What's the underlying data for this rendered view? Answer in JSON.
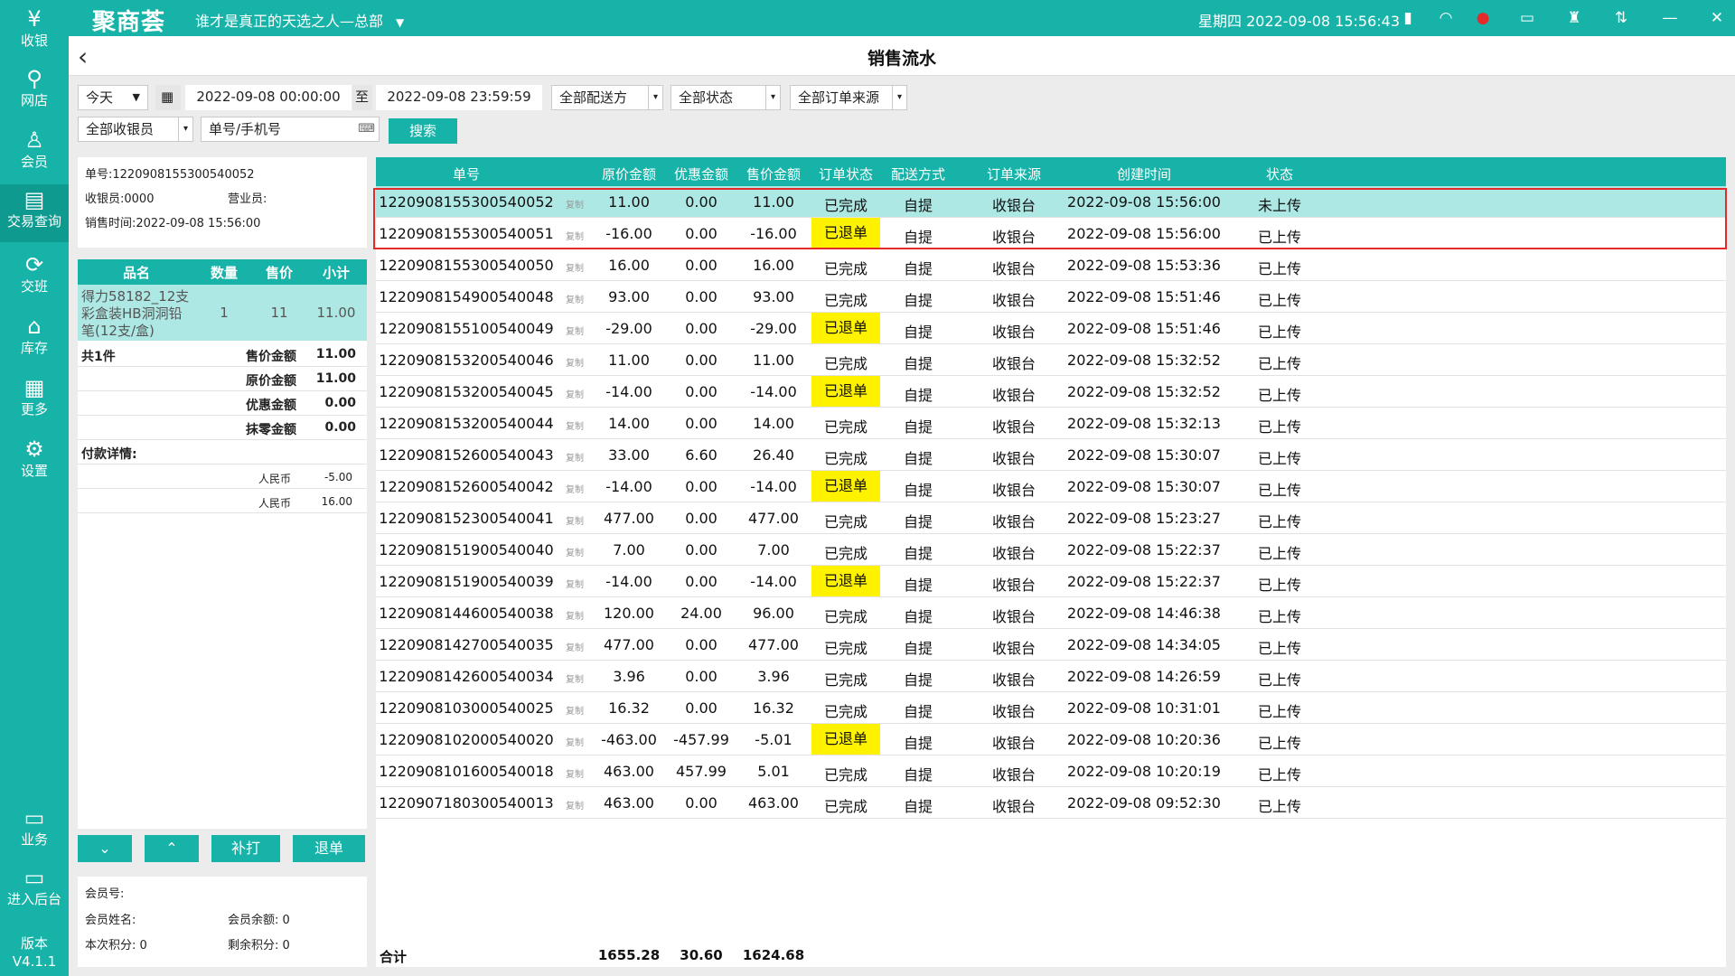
{
  "app": {
    "logo": "聚商荟",
    "store_name": "谁才是真正的天选之人—总部",
    "datetime": "星期四 2022-09-08 15:56:43"
  },
  "sidebar": {
    "items": [
      {
        "label": "收银",
        "icon": "cash-register-icon"
      },
      {
        "label": "网店",
        "icon": "bike-icon"
      },
      {
        "label": "会员",
        "icon": "user-icon"
      },
      {
        "label": "交易查询",
        "icon": "document-icon"
      },
      {
        "label": "交班",
        "icon": "shift-icon"
      },
      {
        "label": "库存",
        "icon": "warehouse-icon"
      },
      {
        "label": "更多",
        "icon": "grid-icon"
      },
      {
        "label": "设置",
        "icon": "gear-icon"
      },
      {
        "label": "业务",
        "icon": "clipboard-icon"
      },
      {
        "label": "进入后台",
        "icon": "monitor-icon"
      }
    ],
    "version_label": "版本",
    "version": "V4.1.1"
  },
  "page": {
    "title": "销售流水"
  },
  "filters": {
    "period": "今天",
    "start": "2022-09-08 00:00:00",
    "to": "至",
    "end": "2022-09-08 23:59:59",
    "delivery": "全部配送方",
    "status": "全部状态",
    "source": "全部订单来源",
    "cashier": "全部收银员",
    "search_placeholder": "单号/手机号",
    "search_button": "搜索"
  },
  "detail": {
    "order_no": "单号:1220908155300540052",
    "cashier": "收银员:0000",
    "salesperson": "营业员:",
    "time": "销售时间:2022-09-08 15:56:00",
    "item_headers": {
      "name": "品名",
      "qty": "数量",
      "price": "售价",
      "subtotal": "小计"
    },
    "item": {
      "name": "得力58182_12支彩盒装HB洞洞铅笔(12支/盒)",
      "qty": "1",
      "price": "11",
      "subtotal": "11.00"
    },
    "count": "共1件",
    "sums": [
      {
        "label": "售价金额",
        "value": "11.00"
      },
      {
        "label": "原价金额",
        "value": "11.00"
      },
      {
        "label": "优惠金额",
        "value": "0.00"
      },
      {
        "label": "抹零金额",
        "value": "0.00"
      }
    ],
    "pay_title": "付款详情:",
    "payments": [
      {
        "method": "人民币",
        "amount": "-5.00"
      },
      {
        "method": "人民币",
        "amount": "16.00"
      }
    ],
    "buttons": {
      "reprint": "补打",
      "refund": "退单"
    },
    "member": {
      "no": "会员号:",
      "name": "会员姓名:",
      "balance": "会员余额:  0",
      "points": "本次积分:  0",
      "remaining": "剩余积分:  0"
    }
  },
  "table": {
    "headers": [
      "单号",
      "原价金额",
      "优惠金额",
      "售价金额",
      "订单状态",
      "配送方式",
      "订单来源",
      "创建时间",
      "状态"
    ],
    "copy_label": "复制",
    "rows": [
      {
        "no": "1220908155300540052",
        "orig": "11.00",
        "disc": "0.00",
        "sale": "11.00",
        "status": "已完成",
        "delivery": "自提",
        "source": "收银台",
        "time": "2022-09-08 15:56:00",
        "upload": "未上传"
      },
      {
        "no": "1220908155300540051",
        "orig": "-16.00",
        "disc": "0.00",
        "sale": "-16.00",
        "status": "已退单",
        "delivery": "自提",
        "source": "收银台",
        "time": "2022-09-08 15:56:00",
        "upload": "已上传"
      },
      {
        "no": "1220908155300540050",
        "orig": "16.00",
        "disc": "0.00",
        "sale": "16.00",
        "status": "已完成",
        "delivery": "自提",
        "source": "收银台",
        "time": "2022-09-08 15:53:36",
        "upload": "已上传"
      },
      {
        "no": "1220908154900540048",
        "orig": "93.00",
        "disc": "0.00",
        "sale": "93.00",
        "status": "已完成",
        "delivery": "自提",
        "source": "收银台",
        "time": "2022-09-08 15:51:46",
        "upload": "已上传"
      },
      {
        "no": "1220908155100540049",
        "orig": "-29.00",
        "disc": "0.00",
        "sale": "-29.00",
        "status": "已退单",
        "delivery": "自提",
        "source": "收银台",
        "time": "2022-09-08 15:51:46",
        "upload": "已上传"
      },
      {
        "no": "1220908153200540046",
        "orig": "11.00",
        "disc": "0.00",
        "sale": "11.00",
        "status": "已完成",
        "delivery": "自提",
        "source": "收银台",
        "time": "2022-09-08 15:32:52",
        "upload": "已上传"
      },
      {
        "no": "1220908153200540045",
        "orig": "-14.00",
        "disc": "0.00",
        "sale": "-14.00",
        "status": "已退单",
        "delivery": "自提",
        "source": "收银台",
        "time": "2022-09-08 15:32:52",
        "upload": "已上传"
      },
      {
        "no": "1220908153200540044",
        "orig": "14.00",
        "disc": "0.00",
        "sale": "14.00",
        "status": "已完成",
        "delivery": "自提",
        "source": "收银台",
        "time": "2022-09-08 15:32:13",
        "upload": "已上传"
      },
      {
        "no": "1220908152600540043",
        "orig": "33.00",
        "disc": "6.60",
        "sale": "26.40",
        "status": "已完成",
        "delivery": "自提",
        "source": "收银台",
        "time": "2022-09-08 15:30:07",
        "upload": "已上传"
      },
      {
        "no": "1220908152600540042",
        "orig": "-14.00",
        "disc": "0.00",
        "sale": "-14.00",
        "status": "已退单",
        "delivery": "自提",
        "source": "收银台",
        "time": "2022-09-08 15:30:07",
        "upload": "已上传"
      },
      {
        "no": "1220908152300540041",
        "orig": "477.00",
        "disc": "0.00",
        "sale": "477.00",
        "status": "已完成",
        "delivery": "自提",
        "source": "收银台",
        "time": "2022-09-08 15:23:27",
        "upload": "已上传"
      },
      {
        "no": "1220908151900540040",
        "orig": "7.00",
        "disc": "0.00",
        "sale": "7.00",
        "status": "已完成",
        "delivery": "自提",
        "source": "收银台",
        "time": "2022-09-08 15:22:37",
        "upload": "已上传"
      },
      {
        "no": "1220908151900540039",
        "orig": "-14.00",
        "disc": "0.00",
        "sale": "-14.00",
        "status": "已退单",
        "delivery": "自提",
        "source": "收银台",
        "time": "2022-09-08 15:22:37",
        "upload": "已上传"
      },
      {
        "no": "1220908144600540038",
        "orig": "120.00",
        "disc": "24.00",
        "sale": "96.00",
        "status": "已完成",
        "delivery": "自提",
        "source": "收银台",
        "time": "2022-09-08 14:46:38",
        "upload": "已上传"
      },
      {
        "no": "1220908142700540035",
        "orig": "477.00",
        "disc": "0.00",
        "sale": "477.00",
        "status": "已完成",
        "delivery": "自提",
        "source": "收银台",
        "time": "2022-09-08 14:34:05",
        "upload": "已上传"
      },
      {
        "no": "1220908142600540034",
        "orig": "3.96",
        "disc": "0.00",
        "sale": "3.96",
        "status": "已完成",
        "delivery": "自提",
        "source": "收银台",
        "time": "2022-09-08 14:26:59",
        "upload": "已上传"
      },
      {
        "no": "1220908103000540025",
        "orig": "16.32",
        "disc": "0.00",
        "sale": "16.32",
        "status": "已完成",
        "delivery": "自提",
        "source": "收银台",
        "time": "2022-09-08 10:31:01",
        "upload": "已上传"
      },
      {
        "no": "1220908102000540020",
        "orig": "-463.00",
        "disc": "-457.99",
        "sale": "-5.01",
        "status": "已退单",
        "delivery": "自提",
        "source": "收银台",
        "time": "2022-09-08 10:20:36",
        "upload": "已上传"
      },
      {
        "no": "1220908101600540018",
        "orig": "463.00",
        "disc": "457.99",
        "sale": "5.01",
        "status": "已完成",
        "delivery": "自提",
        "source": "收银台",
        "time": "2022-09-08 10:20:19",
        "upload": "已上传"
      },
      {
        "no": "1220907180300540013",
        "orig": "463.00",
        "disc": "0.00",
        "sale": "463.00",
        "status": "已完成",
        "delivery": "自提",
        "source": "收银台",
        "time": "2022-09-08 09:52:30",
        "upload": "已上传"
      }
    ],
    "totals": {
      "label": "合计",
      "orig": "1655.28",
      "disc": "30.60",
      "sale": "1624.68"
    }
  },
  "colors": {
    "primary": "#17b3a8",
    "selected_row": "#aee8e4",
    "refund_badge": "#fff200",
    "highlight_border": "#e52a2a"
  }
}
